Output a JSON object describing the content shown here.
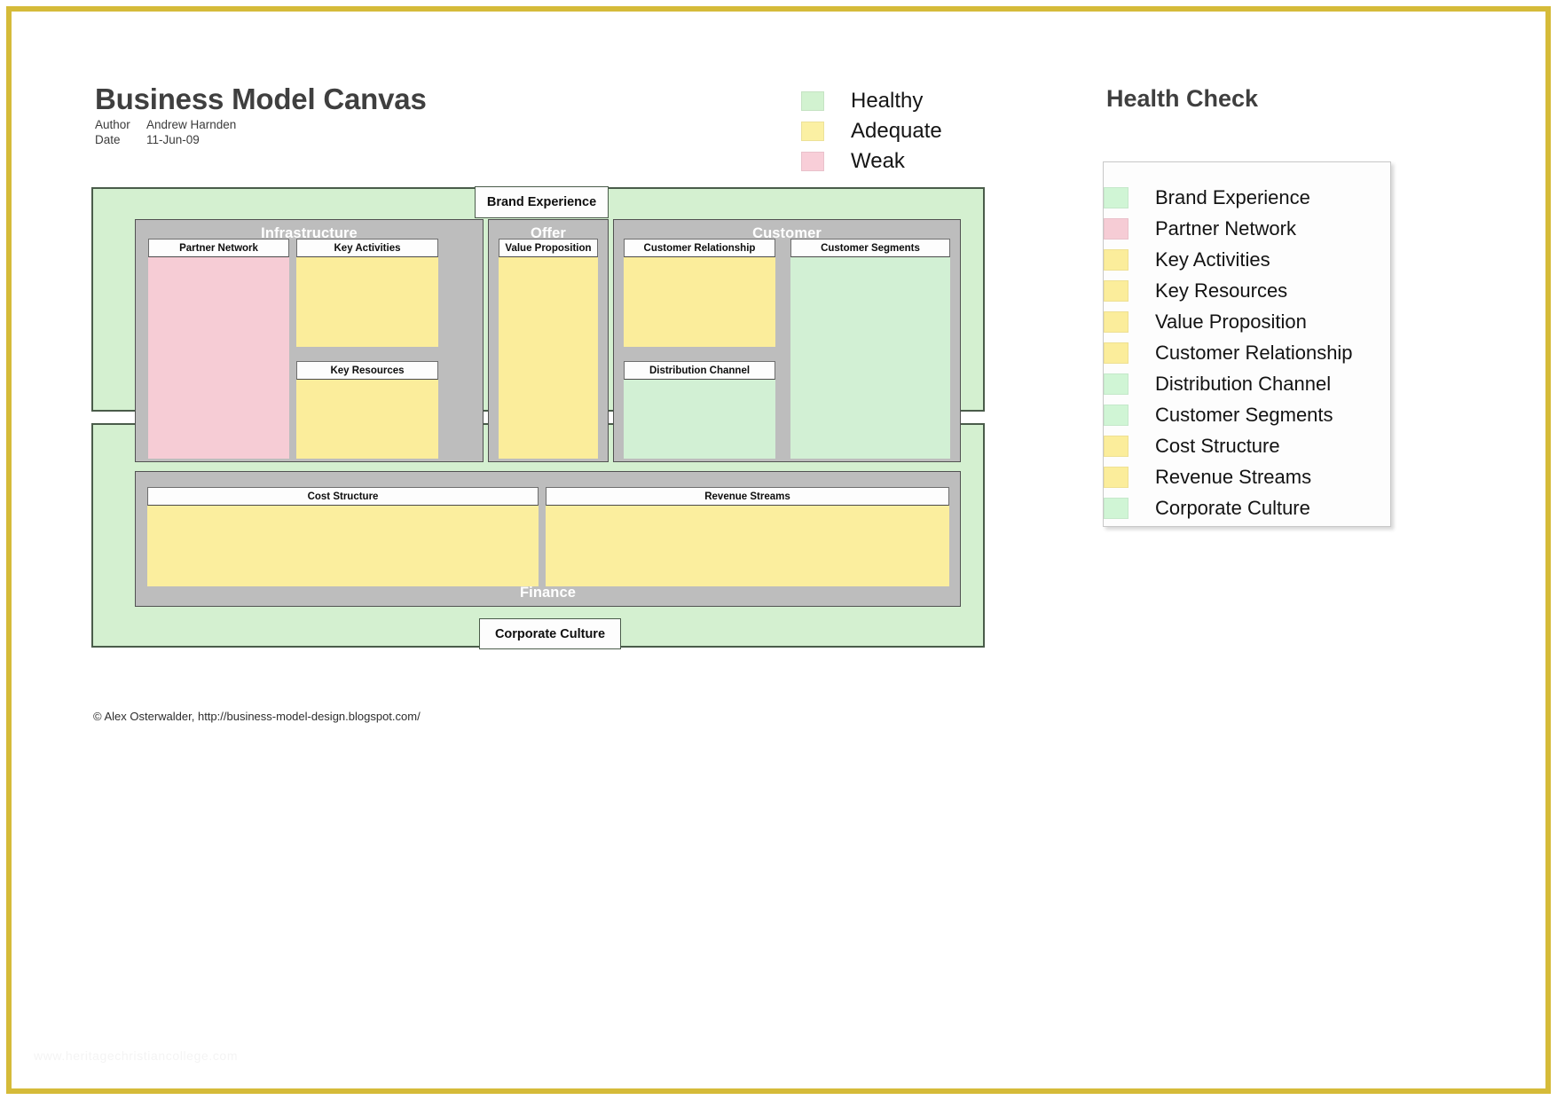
{
  "page": {
    "border_color": "#d5bb39",
    "background": "#ffffff"
  },
  "title_block": {
    "title": "Business Model Canvas",
    "author_label": "Author",
    "author_value": "Andrew Harnden",
    "date_label": "Date",
    "date_value": "11-Jun-09"
  },
  "legend": {
    "items": [
      {
        "label": "Healthy",
        "color": "#d2f2d0"
      },
      {
        "label": "Adequate",
        "color": "#fbf0a3"
      },
      {
        "label": "Weak",
        "color": "#f8ced8"
      }
    ]
  },
  "health_check": {
    "title": "Health Check",
    "items": [
      {
        "label": "Brand Experience",
        "status": "Healthy",
        "color": "#d0f5d5"
      },
      {
        "label": "Partner Network",
        "status": "Weak",
        "color": "#f6ccd5"
      },
      {
        "label": "Key Activities",
        "status": "Adequate",
        "color": "#fbed9b"
      },
      {
        "label": "Key Resources",
        "status": "Adequate",
        "color": "#fbed9b"
      },
      {
        "label": "Value Proposition",
        "status": "Adequate",
        "color": "#fbed9b"
      },
      {
        "label": "Customer Relationship",
        "status": "Adequate",
        "color": "#fbed9b"
      },
      {
        "label": "Distribution Channel",
        "status": "Healthy",
        "color": "#d0f5d5"
      },
      {
        "label": "Customer Segments",
        "status": "Healthy",
        "color": "#d0f5d5"
      },
      {
        "label": "Cost Structure",
        "status": "Adequate",
        "color": "#fbed9b"
      },
      {
        "label": "Revenue Streams",
        "status": "Adequate",
        "color": "#fbed9b"
      },
      {
        "label": "Corporate Culture",
        "status": "Healthy",
        "color": "#d0f5d5"
      }
    ]
  },
  "canvas": {
    "outer_tabs": {
      "brand_experience": "Brand Experience",
      "corporate_culture": "Corporate Culture"
    },
    "sections": {
      "infrastructure": "Infrastructure",
      "offer": "Offer",
      "customer": "Customer",
      "finance": "Finance"
    },
    "blocks": {
      "partner_network": {
        "label": "Partner Network",
        "color": "#f6ccd5"
      },
      "key_activities": {
        "label": "Key Activities",
        "color": "#fbed9b"
      },
      "key_resources": {
        "label": "Key Resources",
        "color": "#fbed9b"
      },
      "value_proposition": {
        "label": "Value Proposition",
        "color": "#fbed9b"
      },
      "customer_relationship": {
        "label": "Customer Relationship",
        "color": "#fbed9b"
      },
      "distribution_channel": {
        "label": "Distribution Channel",
        "color": "#d2f0d4"
      },
      "customer_segments": {
        "label": "Customer Segments",
        "color": "#d2f0d4"
      },
      "cost_structure": {
        "label": "Cost Structure",
        "color": "#fbee9e"
      },
      "revenue_streams": {
        "label": "Revenue Streams",
        "color": "#fbee9e"
      }
    }
  },
  "footer": {
    "copyright": "© Alex Osterwalder, http://business-model-design.blogspot.com/",
    "watermark": "www.heritagechristiancollege.com"
  }
}
